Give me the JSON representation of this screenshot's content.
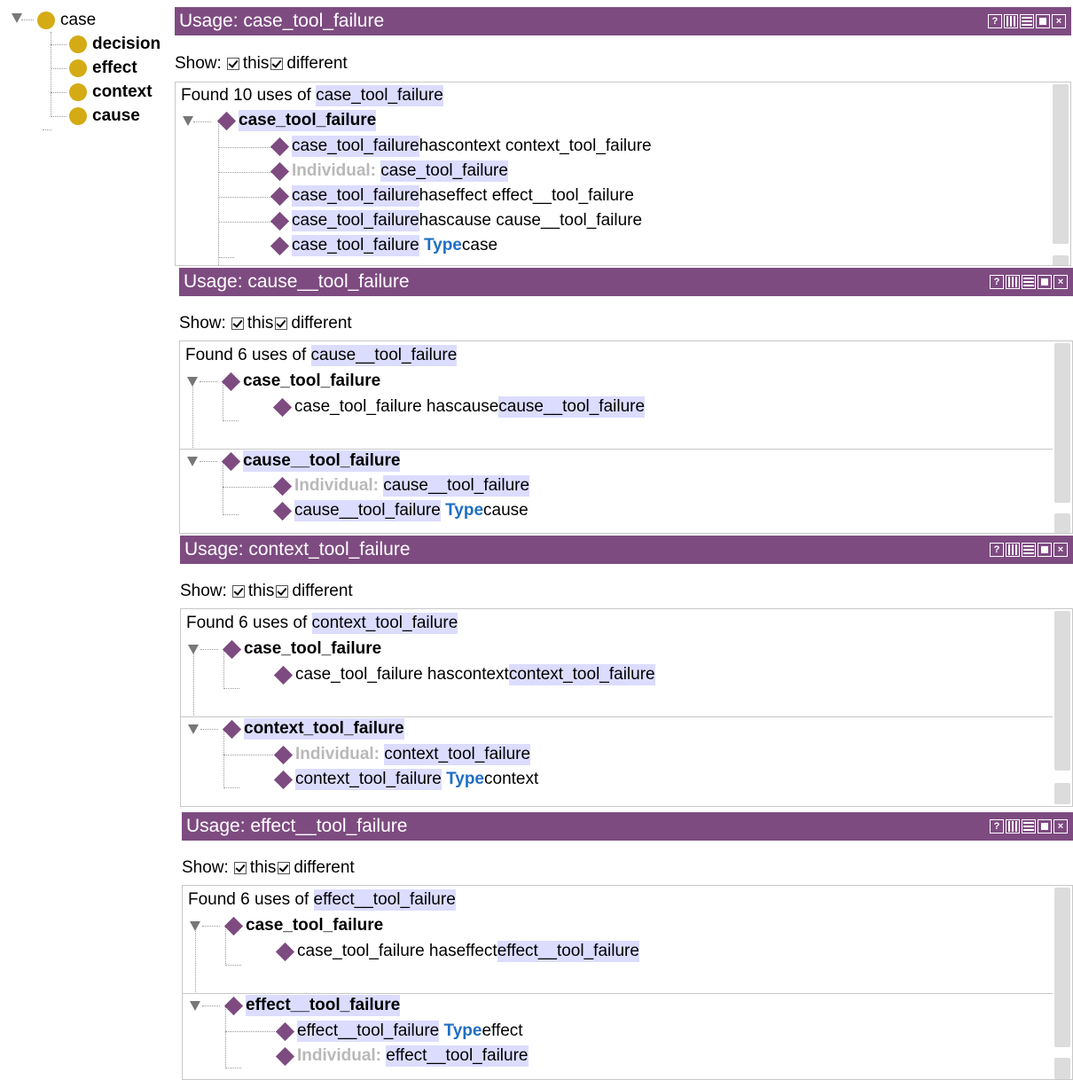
{
  "class_tree": {
    "root": "case",
    "children": [
      "decision",
      "effect",
      "context",
      "cause"
    ],
    "icon": "class-circle-icon",
    "icon_color": "#d4ab14"
  },
  "colors": {
    "titlebar": "#7e4b81",
    "diamond": "#7e4b81",
    "highlight": "#dcdcff",
    "keyword": "#1f6fc4"
  },
  "panels": [
    {
      "title": "Usage: case_tool_failure",
      "show_label": "Show:",
      "this_label": "this",
      "different_label": "different",
      "found_prefix": "Found 10 uses of",
      "found_entity": "case_tool_failure",
      "groups": [
        {
          "header": "case_tool_failure",
          "rows": [
            [
              "case_tool_failure",
              " hascontext context_tool_failure"
            ],
            [
              "Individual:",
              "case_tool_failure"
            ],
            [
              "case_tool_failure",
              " haseffect effect__tool_failure"
            ],
            [
              "case_tool_failure",
              " hascause cause__tool_failure"
            ],
            [
              "case_tool_failure",
              "Type",
              " case"
            ]
          ]
        }
      ]
    },
    {
      "title": "Usage: cause__tool_failure",
      "show_label": "Show:",
      "this_label": "this",
      "different_label": "different",
      "found_prefix": "Found 6 uses of",
      "found_entity": "cause__tool_failure",
      "groups": [
        {
          "header": "case_tool_failure",
          "rows": [
            [
              "case_tool_failure hascause ",
              "cause__tool_failure"
            ]
          ]
        },
        {
          "header": "cause__tool_failure",
          "rows": [
            [
              "Individual:",
              "cause__tool_failure"
            ],
            [
              "cause__tool_failure",
              "Type",
              " cause"
            ]
          ]
        }
      ]
    },
    {
      "title": "Usage: context_tool_failure",
      "show_label": "Show:",
      "this_label": "this",
      "different_label": "different",
      "found_prefix": "Found 6 uses of",
      "found_entity": "context_tool_failure",
      "groups": [
        {
          "header": "case_tool_failure",
          "rows": [
            [
              "case_tool_failure hascontext ",
              "context_tool_failure"
            ]
          ]
        },
        {
          "header": "context_tool_failure",
          "rows": [
            [
              "Individual:",
              "context_tool_failure"
            ],
            [
              "context_tool_failure",
              "Type",
              " context"
            ]
          ]
        }
      ]
    },
    {
      "title": "Usage: effect__tool_failure",
      "show_label": "Show:",
      "this_label": "this",
      "different_label": "different",
      "found_prefix": "Found 6 uses of",
      "found_entity": "effect__tool_failure",
      "groups": [
        {
          "header": "case_tool_failure",
          "rows": [
            [
              "case_tool_failure haseffect ",
              "effect__tool_failure"
            ]
          ]
        },
        {
          "header": "effect__tool_failure",
          "rows": [
            [
              "effect__tool_failure",
              "Type",
              " effect"
            ],
            [
              "Individual:",
              "effect__tool_failure"
            ]
          ]
        }
      ]
    }
  ],
  "titlebar_buttons": [
    "help-icon",
    "split-vertical-icon",
    "split-horizontal-icon",
    "maximize-icon",
    "close-icon"
  ],
  "help_glyph": "?",
  "close_glyph": "×"
}
